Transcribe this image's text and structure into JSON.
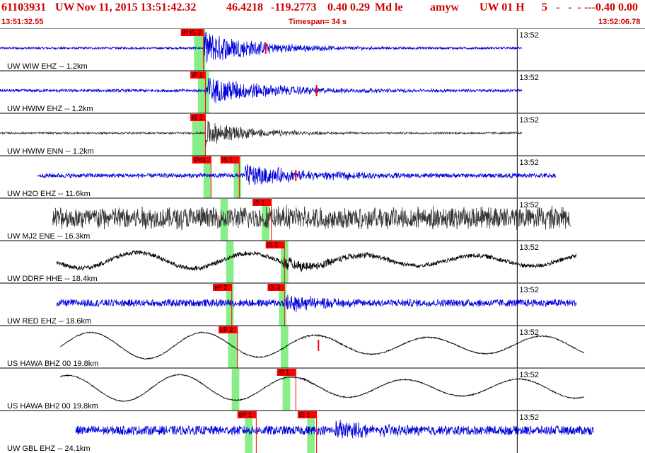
{
  "header": {
    "event_id": "61103931",
    "network": "UW",
    "datetime": "Nov 11, 2015 13:51:42.32",
    "lat": "46.4218",
    "lon": "-119.2773",
    "mag1": "0.40",
    "mag2": "0.29",
    "mag_type": "Md le",
    "author": "amyw",
    "net_code": "UW 01 H",
    "col_5": "5",
    "dashes": "-   -  - ---",
    "right_vals": "0.40 0.00",
    "start_time": "13:51:32.55",
    "timespan": "Timespan=  34 s",
    "end_time": "13:52:06.78"
  },
  "chart_data": {
    "type": "line",
    "title": "61103931 UW Nov 11, 2015 13:51:42.32",
    "x_range_seconds": [
      0,
      34.23
    ],
    "time_tick_label": "13:52",
    "time_tick_at_s": 27.45,
    "colors": {
      "blue": "#0000dd",
      "gray": "#333333",
      "black": "#000000",
      "pick": "#ff0000",
      "window": "#88ee88"
    },
    "traces": [
      {
        "label": "UW WIW EHZ -- 1.2km",
        "color": "blue",
        "start_s": 0.0,
        "end_s": 27.7,
        "style": "burst",
        "noise": 0.06,
        "burst_amp": 0.95,
        "wave": 0,
        "onset_s": 10.8,
        "decay_s": 3.0,
        "windows_s": [
          [
            10.3,
            10.9
          ]
        ],
        "picks": [
          {
            "label": "iP IS 3",
            "t_s": 10.8,
            "box_w_s": 1.2
          }
        ],
        "extra_picks_s": [
          14.1
        ]
      },
      {
        "label": "UW HWIW EHZ -- 1.2km",
        "color": "blue",
        "start_s": 0.0,
        "end_s": 27.7,
        "style": "burst",
        "noise": 0.08,
        "burst_amp": 0.8,
        "wave": 0,
        "onset_s": 10.9,
        "decay_s": 3.5,
        "windows_s": [
          [
            10.5,
            11.1
          ]
        ],
        "picks": [
          {
            "label": "iP 1",
            "t_s": 10.9,
            "box_w_s": 0.8
          }
        ],
        "extra_picks_s": [
          16.8
        ]
      },
      {
        "label": "UW HWIW ENN -- 1.2km",
        "color": "gray",
        "start_s": 0.0,
        "end_s": 27.7,
        "style": "burst",
        "noise": 0.05,
        "burst_amp": 0.7,
        "wave": 0,
        "onset_s": 10.9,
        "decay_s": 2.5,
        "windows_s": [
          [
            10.2,
            10.9
          ]
        ],
        "picks": [
          {
            "label": "iS 1",
            "t_s": 10.9,
            "box_w_s": 0.8
          }
        ],
        "extra_picks_s": []
      },
      {
        "label": "UW H2O EHZ -- 11.6km",
        "color": "blue",
        "start_s": 2.0,
        "end_s": 29.5,
        "style": "burst",
        "noise": 0.12,
        "burst_amp": 0.6,
        "wave": 0,
        "onset_s": 13.0,
        "decay_s": 3.5,
        "windows_s": [
          [
            10.8,
            11.2
          ],
          [
            12.4,
            12.8
          ]
        ],
        "picks": [
          {
            "label": "iPd1",
            "t_s": 11.2,
            "box_w_s": 1.0
          },
          {
            "label": "iS 1",
            "t_s": 12.7,
            "box_w_s": 1.0
          }
        ],
        "extra_picks_s": [
          15.7
        ]
      },
      {
        "label": "UW MJ2 ENE -- 16.3km",
        "color": "gray",
        "start_s": 2.8,
        "end_s": 30.3,
        "style": "noise",
        "noise": 0.55,
        "burst_amp": 0.2,
        "wave": 0,
        "onset_s": 14.2,
        "decay_s": 1.5,
        "windows_s": [
          [
            11.7,
            12.1
          ],
          [
            13.9,
            14.3
          ]
        ],
        "picks": [
          {
            "label": "iS 1",
            "t_s": 14.4,
            "box_w_s": 1.0
          }
        ],
        "extra_picks_s": []
      },
      {
        "label": "UW DDRF HHE -- 18.4km",
        "color": "black",
        "start_s": 3.0,
        "end_s": 30.6,
        "style": "wave",
        "noise": 0.12,
        "burst_amp": 0.35,
        "wave": 0.45,
        "onset_s": 15.0,
        "decay_s": 3.0,
        "windows_s": [
          [
            12.0,
            12.4
          ],
          [
            14.9,
            15.3
          ]
        ],
        "picks": [
          {
            "label": "iS 1",
            "t_s": 15.1,
            "box_w_s": 1.0
          }
        ],
        "extra_picks_s": []
      },
      {
        "label": "UW RED EHZ -- 18.6km",
        "color": "blue",
        "start_s": 3.0,
        "end_s": 30.6,
        "style": "burst",
        "noise": 0.2,
        "burst_amp": 0.5,
        "wave": 0,
        "onset_s": 15.1,
        "decay_s": 2.0,
        "windows_s": [
          [
            12.0,
            12.4
          ],
          [
            14.8,
            15.2
          ]
        ],
        "picks": [
          {
            "label": "eP 2",
            "t_s": 12.3,
            "box_w_s": 1.0
          },
          {
            "label": "iS 3",
            "t_s": 15.1,
            "box_w_s": 0.9
          }
        ],
        "extra_picks_s": []
      },
      {
        "label": "US HAWA BHZ 00 19.8km",
        "color": "black",
        "start_s": 3.2,
        "end_s": 31.0,
        "style": "wave",
        "noise": 0.03,
        "burst_amp": 0.05,
        "wave": 0.75,
        "onset_s": 16.0,
        "decay_s": 2.0,
        "windows_s": [
          [
            12.1,
            12.6
          ],
          [
            14.9,
            15.3
          ]
        ],
        "picks": [
          {
            "label": "eP 2",
            "t_s": 12.6,
            "box_w_s": 1.0
          }
        ],
        "extra_picks_s": [
          16.9
        ]
      },
      {
        "label": "US HAWA BH2 00 19.8km",
        "color": "black",
        "start_s": 3.2,
        "end_s": 31.0,
        "style": "wave",
        "noise": 0.03,
        "burst_amp": 0.05,
        "wave": 0.75,
        "onset_s": 16.0,
        "decay_s": 2.0,
        "windows_s": [
          [
            12.3,
            12.7
          ],
          [
            15.0,
            15.4
          ]
        ],
        "picks": [
          {
            "label": "iS 1",
            "t_s": 15.7,
            "box_w_s": 1.0
          }
        ],
        "extra_picks_s": []
      },
      {
        "label": "UW GBL EHZ -- 24.1km",
        "color": "blue",
        "start_s": 4.0,
        "end_s": 31.5,
        "style": "burst",
        "noise": 0.25,
        "burst_amp": 0.5,
        "wave": 0,
        "onset_s": 17.8,
        "decay_s": 2.2,
        "windows_s": [
          [
            13.0,
            13.4
          ],
          [
            16.3,
            16.7
          ]
        ],
        "picks": [
          {
            "label": "eP 2",
            "t_s": 13.6,
            "box_w_s": 1.0
          },
          {
            "label": "iS 1",
            "t_s": 16.8,
            "box_w_s": 1.0
          }
        ],
        "extra_picks_s": []
      }
    ]
  }
}
